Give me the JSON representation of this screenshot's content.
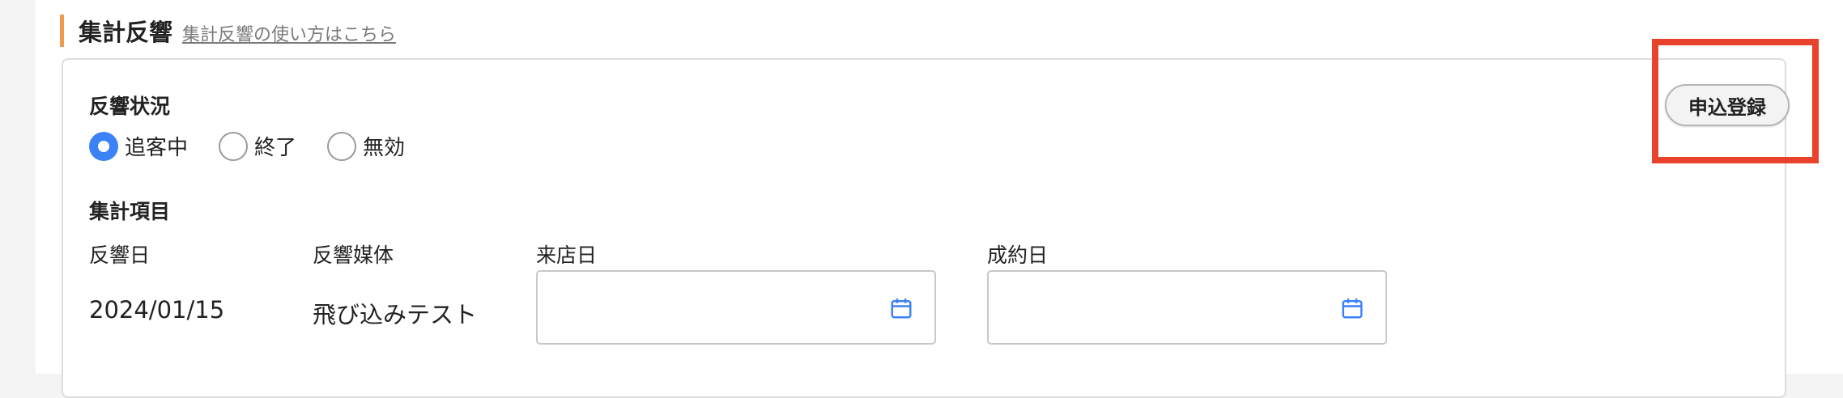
{
  "section": {
    "title": "集計反響",
    "help_link": "集計反響の使い方はこちら"
  },
  "status": {
    "label": "反響状況",
    "options": [
      {
        "label": "追客中",
        "checked": true
      },
      {
        "label": "終了",
        "checked": false
      },
      {
        "label": "無効",
        "checked": false
      }
    ]
  },
  "items": {
    "label": "集計項目",
    "columns": {
      "response_date": {
        "label": "反響日",
        "value": "2024/01/15"
      },
      "media": {
        "label": "反響媒体",
        "value": "飛び込みテスト"
      },
      "visit_date": {
        "label": "来店日",
        "value": ""
      },
      "contract_date": {
        "label": "成約日",
        "value": ""
      }
    }
  },
  "apply_button": {
    "label": "申込登録"
  },
  "colors": {
    "accent": "#ee9b4f",
    "radio_checked": "#3b82f6",
    "calendar_icon": "#3b82f6",
    "highlight": "#e8412c"
  }
}
